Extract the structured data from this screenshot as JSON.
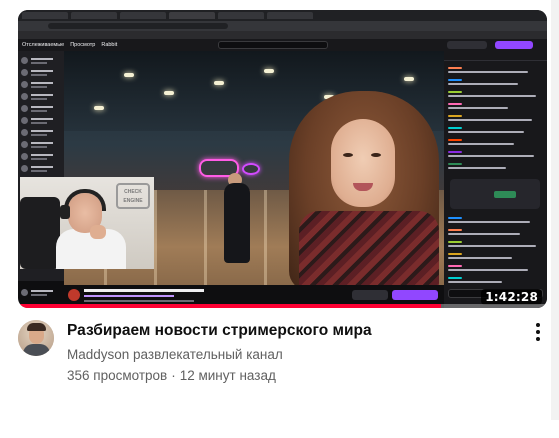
{
  "video": {
    "duration": "1:42:28",
    "watch_progress_fraction": 0.8,
    "title": "Разбираем новости стримерского мира",
    "channel": "Maddyson развлекательный канал",
    "views": "356 просмотров",
    "separator": "·",
    "published": "12 минут назад",
    "menu_icon": "more-vert-icon"
  },
  "thumbnail": {
    "twitch_nav": [
      "Отслеживаемые",
      "Просмотр",
      "Rabbit"
    ],
    "cam_sign": "CHECK ENGINE"
  },
  "colors": {
    "progress": "#ff0033",
    "title": "#0f0f0f",
    "meta": "#606060",
    "twitch_purple": "#9147ff"
  }
}
